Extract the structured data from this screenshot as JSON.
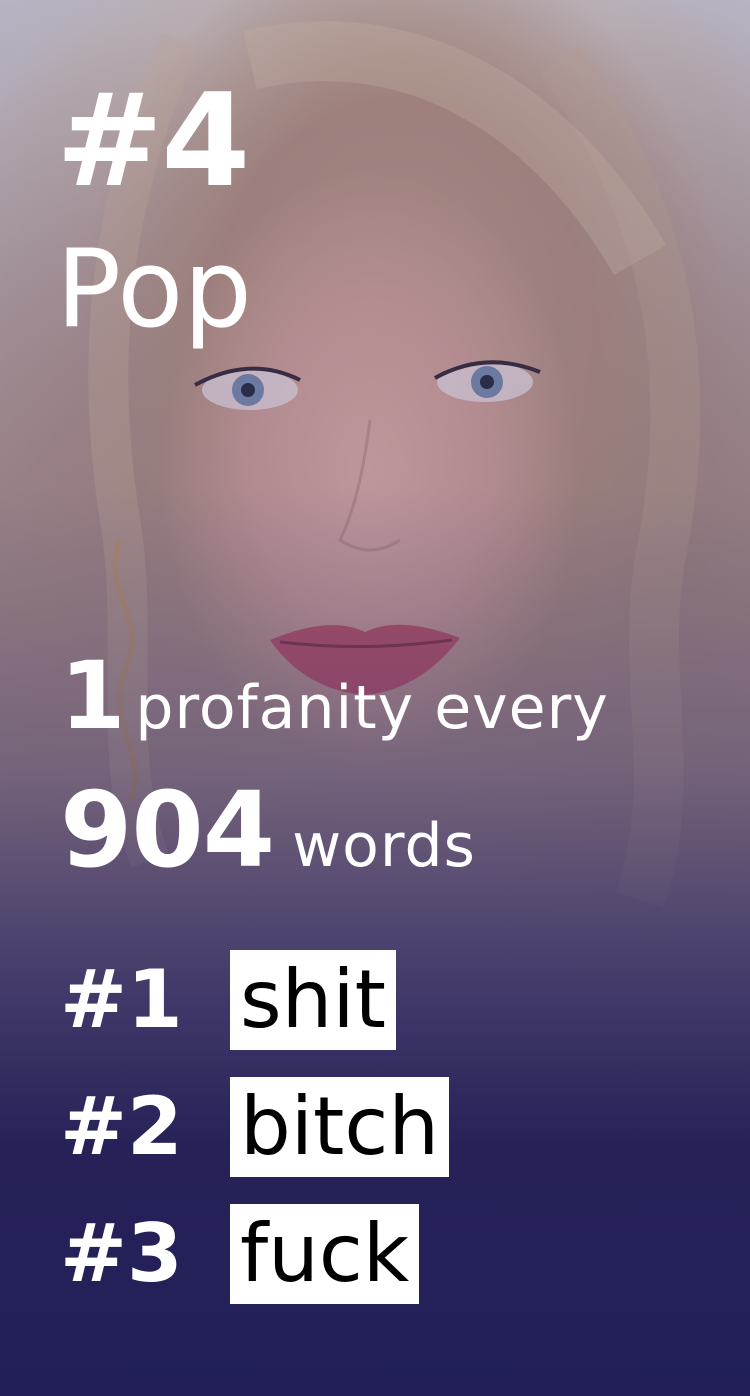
{
  "rank": "#4",
  "genre": "Pop",
  "profanity_rate": {
    "count": "1",
    "unit": "profanity every",
    "words": "904",
    "words_label": "words"
  },
  "top_words": [
    {
      "rank": "#1",
      "word": "shit"
    },
    {
      "rank": "#2",
      "word": "bitch"
    },
    {
      "rank": "#3",
      "word": "fuck"
    }
  ],
  "colors": {
    "overlay": "#221f58",
    "text": "#ffffff",
    "chip_bg": "#ffffff",
    "chip_text": "#000000"
  }
}
